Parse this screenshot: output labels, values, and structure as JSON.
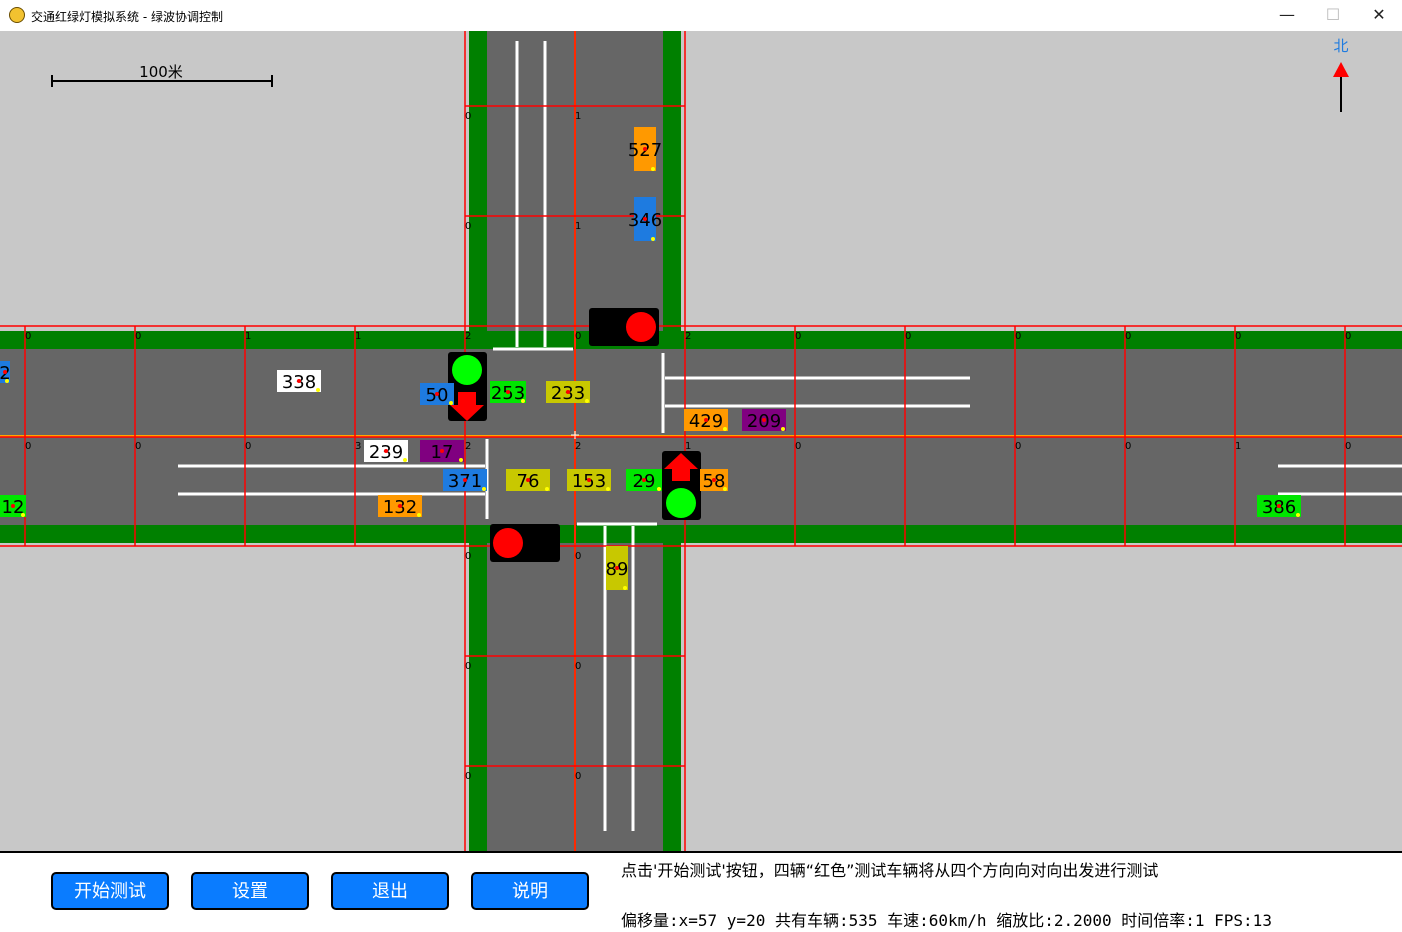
{
  "window": {
    "title": "交通红绿灯模拟系统 - 绿波协调控制",
    "minimize_glyph": "—",
    "maximize_glyph": "☐",
    "close_glyph": "✕"
  },
  "map": {
    "scale_label": "100米",
    "north_label": "北",
    "colors": {
      "grass": "#c8c8c8",
      "road": "#666666",
      "verge": "#008000",
      "grid": "#ff0000",
      "center_line": "#ffa500",
      "signal_red": "#ff0000",
      "signal_green": "#00ff00",
      "compass": "#1e7be0"
    }
  },
  "signals": [
    {
      "id": "north",
      "state": "red"
    },
    {
      "id": "west",
      "state": "green",
      "arrow": "down"
    },
    {
      "id": "east",
      "state": "green",
      "arrow": "up"
    },
    {
      "id": "south",
      "state": "red"
    }
  ],
  "vehicles": [
    {
      "id": "527",
      "color": "#ff9900"
    },
    {
      "id": "346",
      "color": "#1e7be0"
    },
    {
      "id": "338",
      "color": "#ffffff"
    },
    {
      "id": "50",
      "color": "#1e7be0"
    },
    {
      "id": "253",
      "color": "#00e600"
    },
    {
      "id": "233",
      "color": "#c8c800"
    },
    {
      "id": "429",
      "color": "#ff9900"
    },
    {
      "id": "209",
      "color": "#800080"
    },
    {
      "id": "2",
      "color": "#1e7be0"
    },
    {
      "id": "239",
      "color": "#ffffff"
    },
    {
      "id": "17",
      "color": "#800080"
    },
    {
      "id": "371",
      "color": "#1e7be0"
    },
    {
      "id": "76",
      "color": "#c8c800"
    },
    {
      "id": "153",
      "color": "#c8c800"
    },
    {
      "id": "29",
      "color": "#00e600"
    },
    {
      "id": "58",
      "color": "#ff9900"
    },
    {
      "id": "12",
      "color": "#00e600"
    },
    {
      "id": "132",
      "color": "#ff9900"
    },
    {
      "id": "386",
      "color": "#00e600"
    },
    {
      "id": "89",
      "color": "#c8c800"
    }
  ],
  "cell_labels": [
    "0",
    "0",
    "1",
    "1",
    "2",
    "0",
    "2",
    "0",
    "0",
    "0",
    "0",
    "0",
    "0",
    "0",
    "0",
    "3",
    "2",
    "1",
    "0",
    "0",
    "1",
    "0",
    "0",
    "1",
    "0",
    "1",
    "0",
    "0",
    "0",
    "0",
    "2",
    "0",
    "0",
    "0",
    "0"
  ],
  "buttons": {
    "start": "开始测试",
    "settings": "设置",
    "exit": "退出",
    "help": "说明"
  },
  "hint_text": "点击'开始测试'按钮，四辆“红色”测试车辆将从四个方向向对向出发进行测试",
  "status_text": "偏移量:x=57 y=20 共有车辆:535  车速:60km/h 缩放比:2.2000 时间倍率:1 FPS:13"
}
